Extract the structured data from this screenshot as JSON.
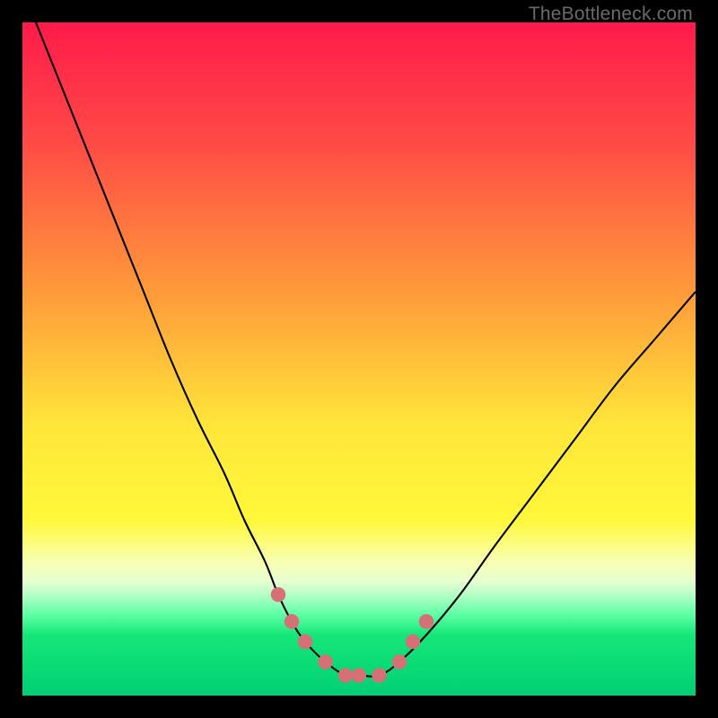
{
  "watermark": "TheBottleneck.com",
  "colors": {
    "frame": "#000000",
    "curve_stroke": "#000000",
    "marker_fill": "#d57077",
    "green_band": "#16e678"
  },
  "chart_data": {
    "type": "line",
    "title": "",
    "xlabel": "",
    "ylabel": "",
    "xlim": [
      0,
      100
    ],
    "ylim": [
      0,
      100
    ],
    "gradient_stops": [
      {
        "offset": 0,
        "color": "#ff1a4b"
      },
      {
        "offset": 18,
        "color": "#ff4b46"
      },
      {
        "offset": 40,
        "color": "#ff9a3a"
      },
      {
        "offset": 60,
        "color": "#ffe63a"
      },
      {
        "offset": 74,
        "color": "#fff83a"
      },
      {
        "offset": 80,
        "color": "#f8ffb0"
      },
      {
        "offset": 83,
        "color": "#e8ffd0"
      },
      {
        "offset": 85,
        "color": "#b6ffc8"
      },
      {
        "offset": 88,
        "color": "#5dffa5"
      },
      {
        "offset": 91,
        "color": "#16e678"
      },
      {
        "offset": 100,
        "color": "#00d074"
      }
    ],
    "series": [
      {
        "name": "bottleneck-curve",
        "x": [
          2,
          6,
          10,
          14,
          18,
          22,
          26,
          30,
          33,
          36,
          38,
          40,
          42,
          45,
          48,
          50,
          53,
          56,
          60,
          65,
          70,
          76,
          82,
          88,
          94,
          100
        ],
        "y": [
          100,
          90,
          80,
          70,
          60,
          50,
          41,
          33,
          26,
          20,
          15,
          11,
          8,
          5,
          3,
          3,
          3,
          5,
          9,
          15,
          22,
          30,
          38,
          46,
          53,
          60
        ]
      }
    ],
    "markers": {
      "name": "bottom-markers",
      "points": [
        {
          "x": 38,
          "y": 15
        },
        {
          "x": 40,
          "y": 11
        },
        {
          "x": 42,
          "y": 8
        },
        {
          "x": 45,
          "y": 5
        },
        {
          "x": 48,
          "y": 3
        },
        {
          "x": 50,
          "y": 3
        },
        {
          "x": 53,
          "y": 3
        },
        {
          "x": 56,
          "y": 5
        },
        {
          "x": 58,
          "y": 8
        },
        {
          "x": 60,
          "y": 11
        }
      ]
    }
  }
}
